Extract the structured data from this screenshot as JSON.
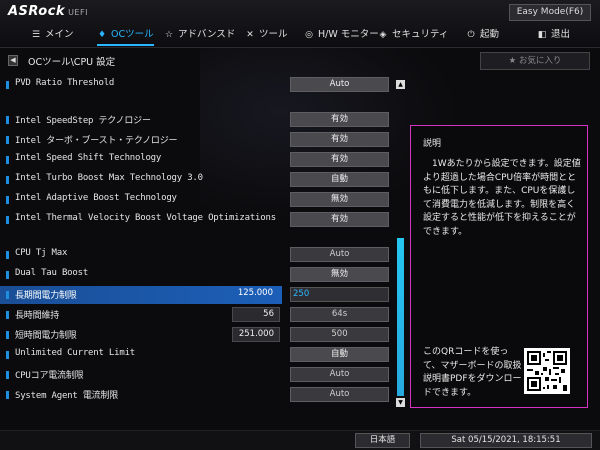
{
  "header": {
    "logo": "ASRock",
    "logo_sub": "UEFI",
    "easy_mode_label": "Easy Mode(F6)"
  },
  "nav": [
    {
      "icon": "main-icon",
      "label": "メイン",
      "active": false
    },
    {
      "icon": "flame-icon",
      "label": "OCツール",
      "active": true
    },
    {
      "icon": "star-icon",
      "label": "アドバンスド",
      "active": false
    },
    {
      "icon": "tools-icon",
      "label": "ツール",
      "active": false
    },
    {
      "icon": "monitor-icon",
      "label": "H/W モニター",
      "active": false
    },
    {
      "icon": "shield-icon",
      "label": "セキュリティ",
      "active": false
    },
    {
      "icon": "power-icon",
      "label": "起動",
      "active": false
    },
    {
      "icon": "exit-icon",
      "label": "退出",
      "active": false
    }
  ],
  "breadcrumb": "OCツール\\CPU 設定",
  "favorite_label": "お気に入り",
  "settings": {
    "pvd_ratio": {
      "label": "PVD Ratio Threshold",
      "value": "Auto"
    },
    "speedstep": {
      "label": "Intel SpeedStep テクノロジー",
      "value": "有効"
    },
    "turbo_boost": {
      "label": "Intel ターボ・ブースト・テクノロジー",
      "value": "有効"
    },
    "speed_shift": {
      "label": "Intel Speed Shift Technology",
      "value": "有効"
    },
    "turbo_max_30": {
      "label": "Intel Turbo Boost Max Technology 3.0",
      "value": "自動"
    },
    "adaptive_boost": {
      "label": "Intel Adaptive Boost Technology",
      "value": "無効"
    },
    "tvb": {
      "label": "Intel Thermal Velocity Boost Voltage Optimizations",
      "value": "有効"
    },
    "cpu_tj_max": {
      "label": "CPU Tj Max",
      "value": "Auto"
    },
    "dual_tau": {
      "label": "Dual Tau Boost",
      "value": "無効"
    },
    "long_power": {
      "label": "長期間電力制限",
      "current": "125.000",
      "value": "250"
    },
    "long_duration": {
      "label": "長時間維持",
      "current": "56",
      "value": "64s"
    },
    "short_power": {
      "label": "短時間電力制限",
      "current": "251.000",
      "value": "500"
    },
    "unlimited_current": {
      "label": "Unlimited Current Limit",
      "value": "自動"
    },
    "cpu_core_current": {
      "label": "CPUコア電流制限",
      "value": "Auto"
    },
    "sa_current": {
      "label": "System Agent 電流制限",
      "value": "Auto"
    }
  },
  "description": {
    "title": "説明",
    "body": "　1Wあたりから設定できます。設定値より超過した場合CPU倍率が時間とともに低下します。また、CPUを保護して消費電力を低減します。制限を高く設定すると性能が低下を抑えることができます。",
    "qr_text": "このQRコードを使って、マザーボードの取扱説明書PDFをダウンロードできます。"
  },
  "footer": {
    "language": "日本語",
    "datetime": "Sat 05/15/2021, 18:15:51"
  },
  "colors": {
    "accent": "#2ab7ff",
    "highlight_row": "#1c5fb8",
    "description_border": "#d632c4",
    "scrollbar": "#25c6f4"
  }
}
